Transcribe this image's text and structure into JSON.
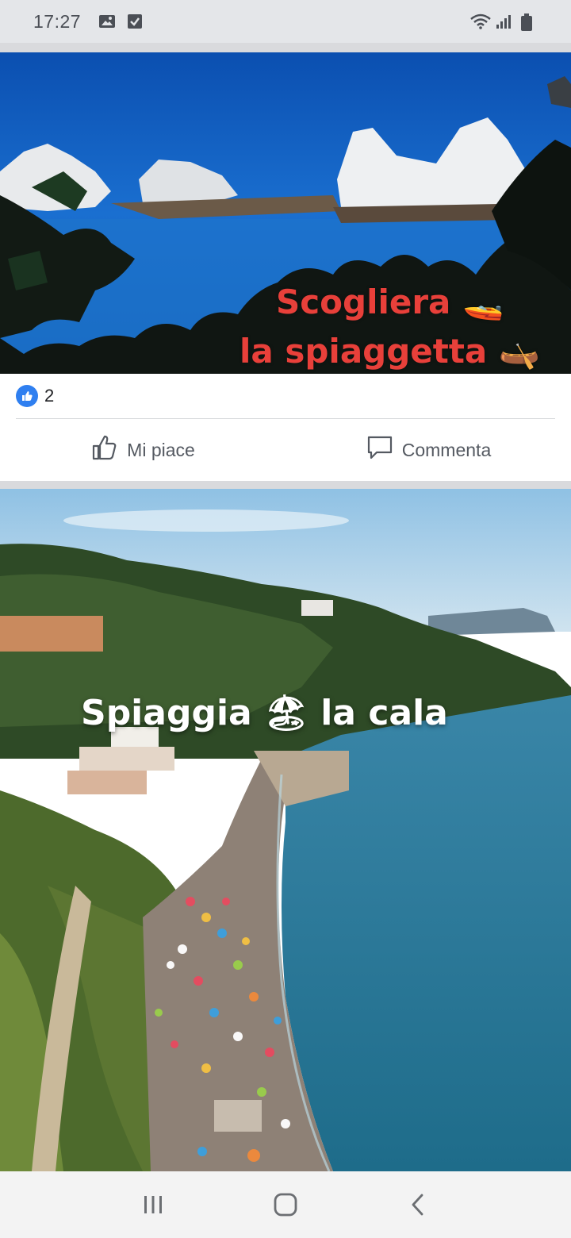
{
  "status_bar": {
    "time": "17:27",
    "left_icons": [
      "gallery-icon",
      "checkbox-icon"
    ],
    "right_icons": [
      "wifi-icon",
      "signal-icon",
      "battery-icon"
    ]
  },
  "posts": [
    {
      "image_text_lines": [
        "Scogliera 🚤",
        "la spiaggetta 🛶"
      ],
      "reaction_count": "2",
      "actions": {
        "like": "Mi piace",
        "comment": "Commenta"
      }
    },
    {
      "image_text": "Spiaggia 🏖 la cala"
    }
  ],
  "nav_bar": {
    "buttons": [
      "recents-icon",
      "home-icon",
      "back-icon"
    ]
  },
  "colors": {
    "like_blue": "#2f7ff0",
    "overlay_red": "#e8403a",
    "sea_blue": "#1565c0",
    "beach_sea": "#2a7a9a"
  }
}
